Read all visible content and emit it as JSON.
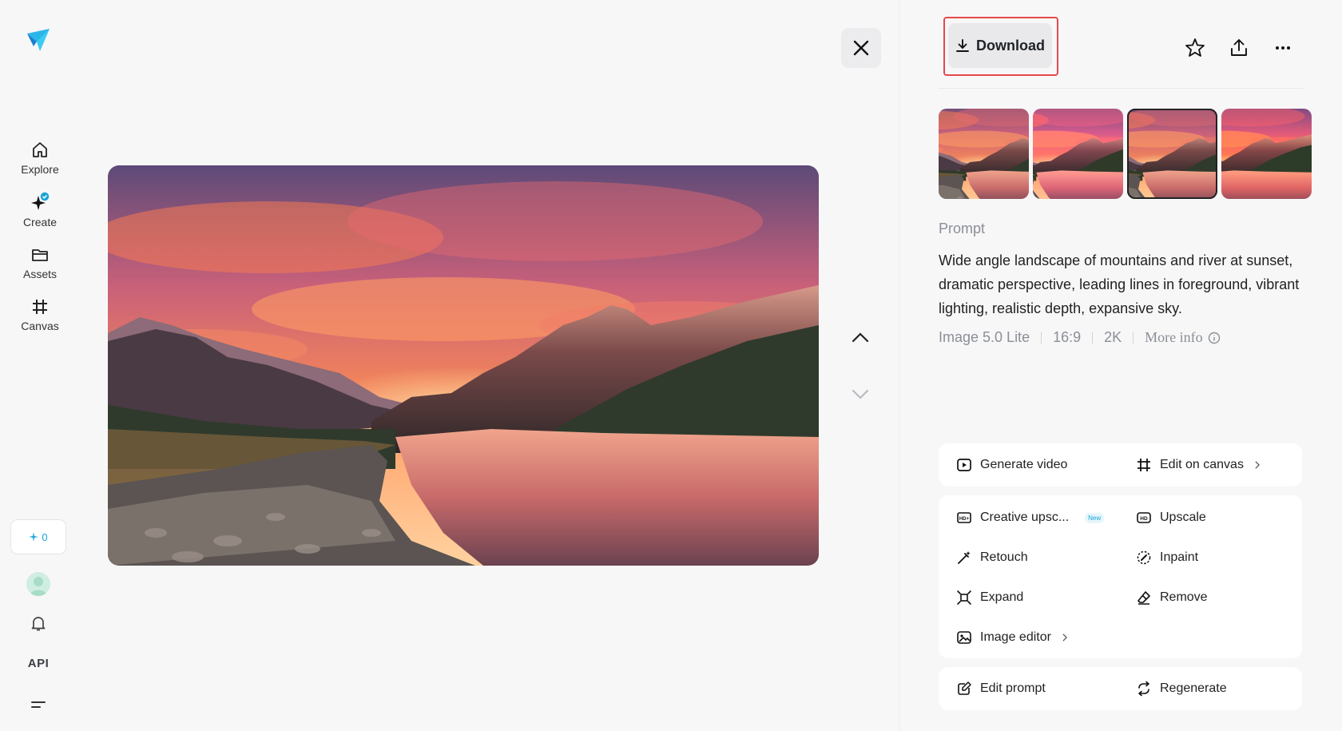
{
  "sidebar": {
    "items": [
      {
        "label": "Explore",
        "icon": "home-icon"
      },
      {
        "label": "Create",
        "icon": "create-sparkle-icon"
      },
      {
        "label": "Assets",
        "icon": "folder-icon"
      },
      {
        "label": "Canvas",
        "icon": "canvas-icon"
      }
    ],
    "credits": "0",
    "api_label": "API"
  },
  "viewer": {
    "image_alt": "Wide angle landscape of mountains and river at sunset"
  },
  "toolbar": {
    "download_label": "Download"
  },
  "thumbnails": {
    "selected_index": 2,
    "count": 4
  },
  "prompt": {
    "title": "Prompt",
    "text": "Wide angle landscape of mountains and river at sunset, dramatic perspective, leading lines in foreground, vibrant lighting, realistic depth, expansive sky.",
    "model": "Image 5.0 Lite",
    "ratio": "16:9",
    "resolution": "2K",
    "more_info": "More info"
  },
  "actions": {
    "generate_video": "Generate video",
    "edit_on_canvas": "Edit on canvas",
    "creative_upscale": "Creative upsc...",
    "new_badge": "New",
    "upscale": "Upscale",
    "retouch": "Retouch",
    "inpaint": "Inpaint",
    "expand": "Expand",
    "remove": "Remove",
    "image_editor": "Image editor",
    "edit_prompt": "Edit prompt",
    "regenerate": "Regenerate"
  },
  "colors": {
    "accent": "#1ba5d8",
    "highlight_border": "#e5484d"
  }
}
